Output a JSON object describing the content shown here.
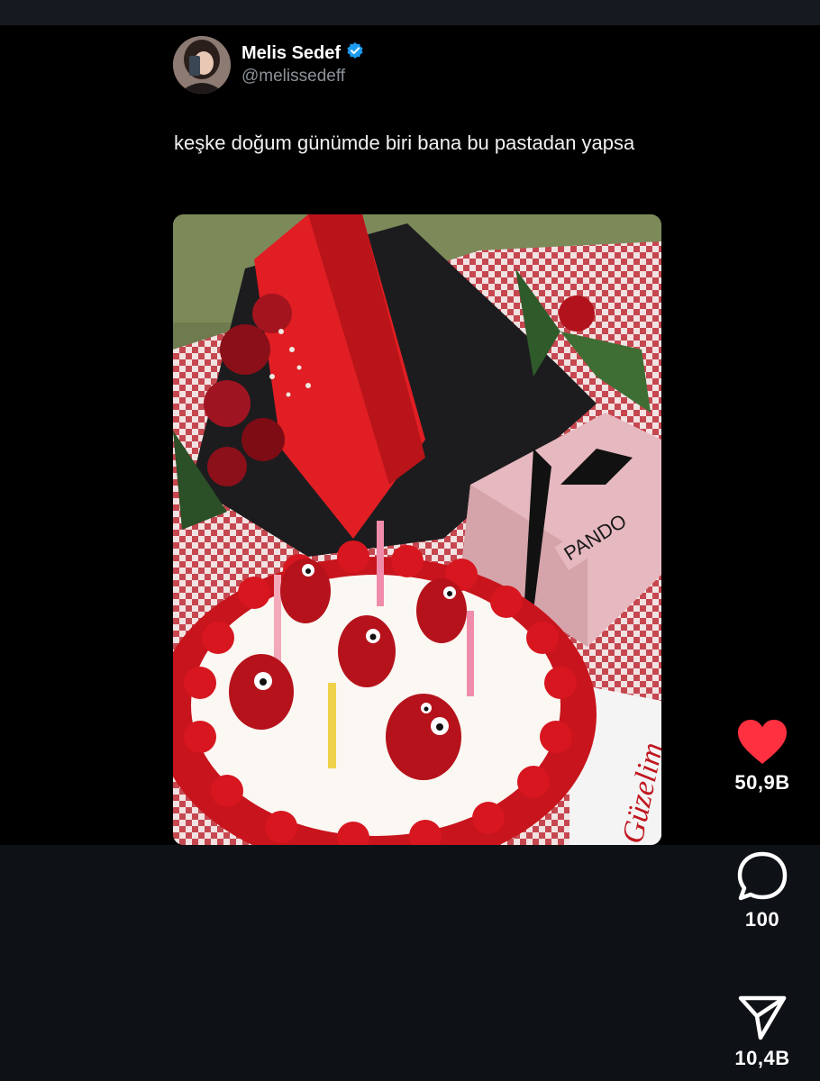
{
  "author": {
    "display_name": "Melis Sedef",
    "handle": "@melissedeff",
    "verified": true,
    "verified_color": "#1d9bf0"
  },
  "tweet": {
    "text": "keşke doğum günümde biri bana bu pastadan yapsa"
  },
  "media": {
    "box_label": "PANDO",
    "cake_writing": "Güzelim"
  },
  "actions": {
    "like": {
      "icon": "heart-icon",
      "count": "50,9B",
      "color": "#ff3040"
    },
    "comment": {
      "icon": "comment-bubble-icon",
      "count": "100"
    },
    "share": {
      "icon": "send-paper-plane-icon",
      "count": "10,4B"
    }
  }
}
